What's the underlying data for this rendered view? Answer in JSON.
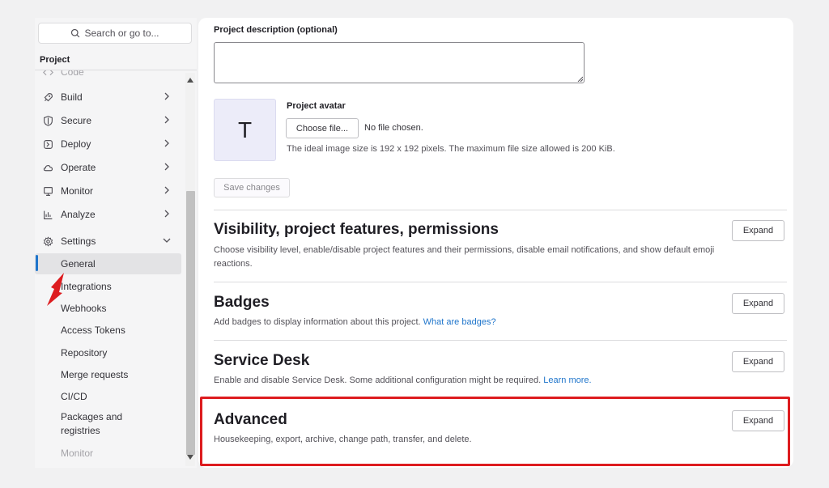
{
  "sidebar": {
    "search_placeholder": "Search or go to...",
    "section_label": "Project",
    "partial_item": "Code",
    "items": [
      {
        "label": "Build",
        "icon": "rocket-icon"
      },
      {
        "label": "Secure",
        "icon": "shield-icon"
      },
      {
        "label": "Deploy",
        "icon": "deploy-icon"
      },
      {
        "label": "Operate",
        "icon": "cloud-icon"
      },
      {
        "label": "Monitor",
        "icon": "monitor-icon"
      },
      {
        "label": "Analyze",
        "icon": "chart-icon"
      },
      {
        "label": "Settings",
        "icon": "gear-icon"
      }
    ],
    "settings_sub": [
      "General",
      "Integrations",
      "Webhooks",
      "Access Tokens",
      "Repository",
      "Merge requests",
      "CI/CD",
      "Packages and registries",
      "Monitor"
    ]
  },
  "form": {
    "description_label": "Project description (optional)",
    "description_value": "",
    "avatar_label": "Project avatar",
    "avatar_letter": "T",
    "choose_file": "Choose file...",
    "file_status": "No file chosen.",
    "avatar_help": "The ideal image size is 192 x 192 pixels. The maximum file size allowed is 200 KiB.",
    "save_label": "Save changes"
  },
  "sections": [
    {
      "title": "Visibility, project features, permissions",
      "desc": "Choose visibility level, enable/disable project features and their permissions, disable email notifications, and show default emoji reactions.",
      "link": "",
      "button": "Expand"
    },
    {
      "title": "Badges",
      "desc": "Add badges to display information about this project.",
      "link": "What are badges?",
      "button": "Expand"
    },
    {
      "title": "Service Desk",
      "desc": "Enable and disable Service Desk. Some additional configuration might be required.",
      "link": "Learn more.",
      "button": "Expand"
    },
    {
      "title": "Advanced",
      "desc": "Housekeeping, export, archive, change path, transfer, and delete.",
      "link": "",
      "button": "Expand"
    }
  ],
  "colors": {
    "highlight": "#dd1c1f",
    "accent": "#1f75cb"
  }
}
